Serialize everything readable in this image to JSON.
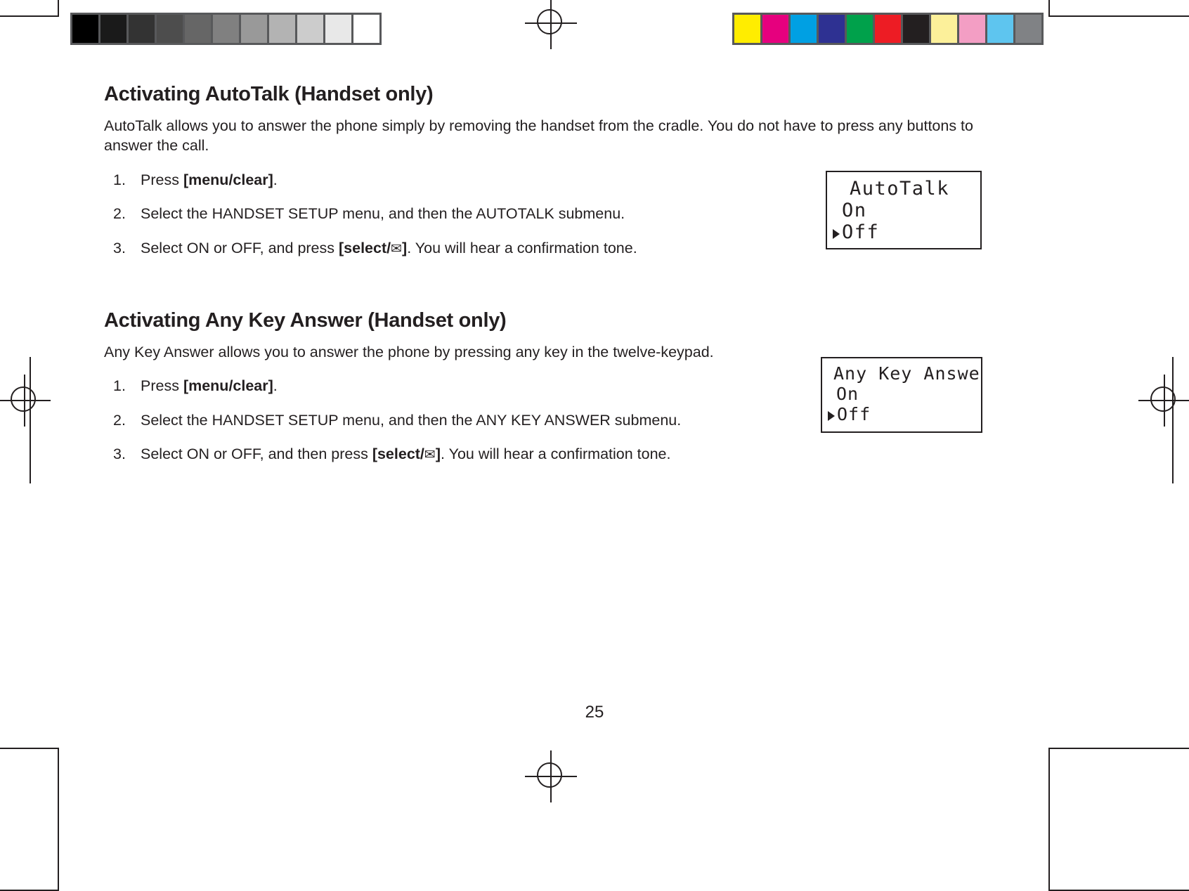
{
  "page": {
    "number": "25"
  },
  "calibration": {
    "grayscale_label": "grayscale-step-wedge",
    "grayscale": [
      "#000000",
      "#1a1a1a",
      "#333333",
      "#4d4d4d",
      "#666666",
      "#808080",
      "#999999",
      "#b3b3b3",
      "#cccccc",
      "#e8e8e8",
      "#ffffff"
    ],
    "colors": [
      "#ffed00",
      "#e6007e",
      "#00a0e3",
      "#2e3192",
      "#00a14b",
      "#ed1c24",
      "#231f20",
      "#fcf09a",
      "#f39ec4",
      "#5ec5ef",
      "#808285"
    ],
    "strip_border": "#58595b"
  },
  "sections": [
    {
      "title": "Activating AutoTalk (Handset only)",
      "intro": "AutoTalk allows you to answer the phone simply by removing the handset from the cradle. You do not have to press any buttons to answer the call.",
      "steps": [
        {
          "prefix": "Press ",
          "bold": "[menu/clear]",
          "suffix": "."
        },
        {
          "prefix": "Select the HANDSET SETUP menu, and then the AUTOTALK submenu.",
          "bold": "",
          "suffix": ""
        },
        {
          "prefix": "Select ON or OFF, and press ",
          "bold": "[select/",
          "icon": "envelope-icon",
          "bold_end": "]",
          "suffix": ". You will hear a confirmation tone."
        }
      ],
      "lcd": {
        "name": "lcd-autotalk",
        "title_line": "AutoTalk",
        "option_1": "On",
        "option_2": "Off",
        "selected": "Off"
      }
    },
    {
      "title": "Activating Any Key Answer (Handset only)",
      "intro": "Any Key Answer allows you to answer the phone by pressing any key in the twelve-keypad.",
      "steps": [
        {
          "prefix": "Press ",
          "bold": "[menu/clear]",
          "suffix": "."
        },
        {
          "prefix": "Select the HANDSET SETUP menu, and then the ANY KEY ANSWER submenu.",
          "bold": "",
          "suffix": ""
        },
        {
          "prefix": "Select ON or OFF, and then press ",
          "bold": "[select/",
          "icon": "envelope-icon",
          "bold_end": "]",
          "suffix": ". You will hear a confirmation tone."
        }
      ],
      "lcd": {
        "name": "lcd-anykey",
        "title_line": "Any Key Answer",
        "option_1": "On",
        "option_2": "Off",
        "selected": "Off"
      }
    }
  ],
  "icons": {
    "envelope": "✉",
    "cursor_arrow": "▶"
  }
}
